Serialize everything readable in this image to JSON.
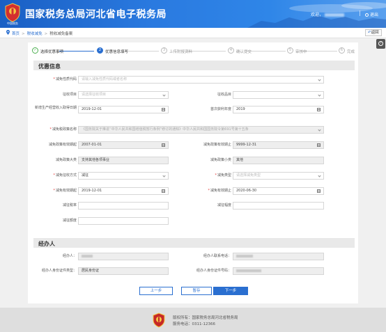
{
  "header": {
    "title": "国家税务总局河北省电子税务局",
    "emblem_text": "中国税务",
    "welcome": "欢迎，",
    "logout": "退出"
  },
  "breadcrumb": {
    "home": "首页",
    "level1": "税收减免",
    "current": "税收减免备案"
  },
  "back_label": "返回",
  "help_icon": "?",
  "steps": [
    {
      "num": "✓",
      "label": "选择优惠事项",
      "state": "done"
    },
    {
      "num": "2",
      "label": "优惠信息填写",
      "state": "active"
    },
    {
      "num": "3",
      "label": "上传附报资料",
      "state": "todo"
    },
    {
      "num": "4",
      "label": "确认提交",
      "state": "todo"
    },
    {
      "num": "5",
      "label": "审核中",
      "state": "todo"
    },
    {
      "num": "6",
      "label": "完成",
      "state": "todo"
    }
  ],
  "sections": {
    "youhui": "优惠信息",
    "jingbanren": "经办人"
  },
  "form": {
    "jmxz_label": "减免性质代码",
    "jmxz_placeholder": "请输入减免性质代码或者名称",
    "zsxm_label": "征收项目",
    "zsxm_placeholder": "请选择征收项目",
    "zspm_label": "征收品目",
    "zspm_placeholder": "",
    "scrq_label": "新增生产经营收入取得日期",
    "scrq_value": "2019-12-01",
    "sbnd_label": "首次获利年度",
    "sbnd_value": "2019",
    "zcyj_label": "减免税政策名称",
    "zcyj_value": "《国务院关于推进“中华人民共和国增值税暂行条例”修订的通知》中华人民共和国国务院令第691号第十五条",
    "yxqq_label": "减免政策有效期起",
    "yxqq_value": "2007-01-01",
    "yxqz_label": "减免政策有效期止",
    "yxqz_value": "9999-12-31",
    "dl_label": "减免政策大类",
    "dl_value": "支持其他各项事业",
    "xl_label": "减免政策小类",
    "xl_value": "其他",
    "jmfs_label": "减免征收方式",
    "jmfs_value": "减征",
    "jmlx_label": "减免类型",
    "jmlx_placeholder": "请选择减免类型",
    "jmqq_label": "减免有效期起",
    "jmqq_value": "2019-12-01",
    "jmqz_label": "减免有效期止",
    "jmqz_value": "2020-06-30",
    "jzsl_label": "减征税率",
    "jzfd_label": "减征幅度",
    "jzed_label": "减征额度"
  },
  "agent": {
    "name_label": "经办人：",
    "phone_label": "经办人联系电话：",
    "idtype_label": "经办人身份证件类型：",
    "idtype_value": "居民身份证",
    "idno_label": "经办人身份证件号码："
  },
  "buttons": {
    "prev": "上一步",
    "save": "暂存",
    "next": "下一步"
  },
  "footer": {
    "line1": "版权所有：国家税务总局河北省税务局",
    "line2": "服务电话：0311-12366"
  },
  "colors": {
    "header_blue": "#2a7ae0",
    "accent": "#2a6fd0",
    "required": "#e53935",
    "step_done": "#4caf50"
  }
}
